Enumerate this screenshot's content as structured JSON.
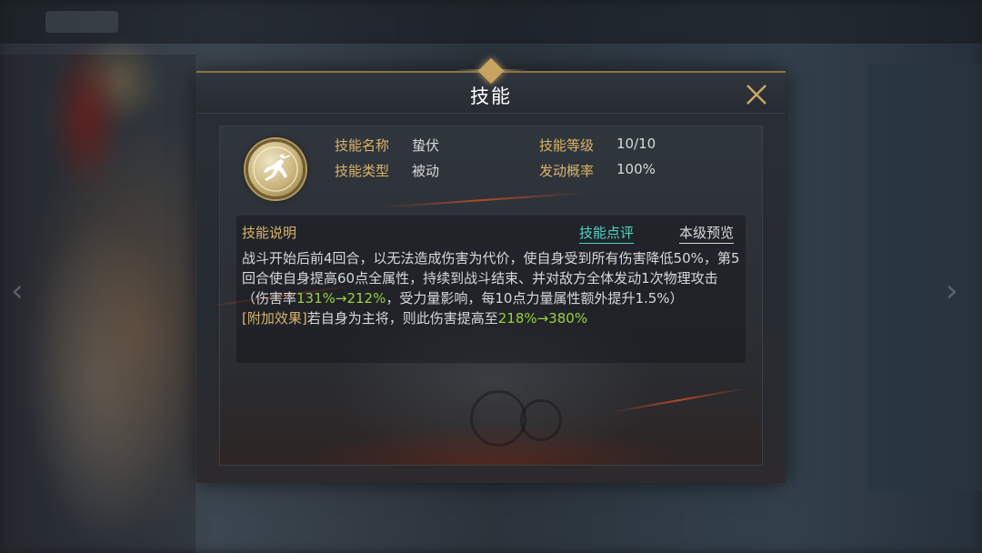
{
  "dialog": {
    "title": "技能",
    "close_icon": "close-x-icon"
  },
  "skill": {
    "icon": "leaping-warrior-icon",
    "name_label": "技能名称",
    "name_value": "蛰伏",
    "type_label": "技能类型",
    "type_value": "被动",
    "level_label": "技能等级",
    "level_value": "10/10",
    "chance_label": "发动概率",
    "chance_value": "100%"
  },
  "description": {
    "header": "技能说明",
    "review_link": "技能点评",
    "preview_link": "本级预览",
    "line1": "战斗开始后前4回合，以无法造成伤害为代价，使自身受到所有伤害降低50%，第5回合使自身提高60点全属性，持续到战斗结束、并对敌方全体发动1次物理攻击（伤害率",
    "damage_rate": "131%→212%",
    "line1_tail": "，受力量影响，每10点力量属性额外提升1.5%）",
    "bonus_tag": "[附加效果]",
    "bonus_text": "若自身为主将，则此伤害提高至",
    "bonus_value": "218%→380%"
  },
  "colors": {
    "label_gold": "#d9b36a",
    "value_text": "#d8d8d8",
    "highlight_green": "#9bd23c",
    "link_cyan": "#4fd3c4"
  }
}
